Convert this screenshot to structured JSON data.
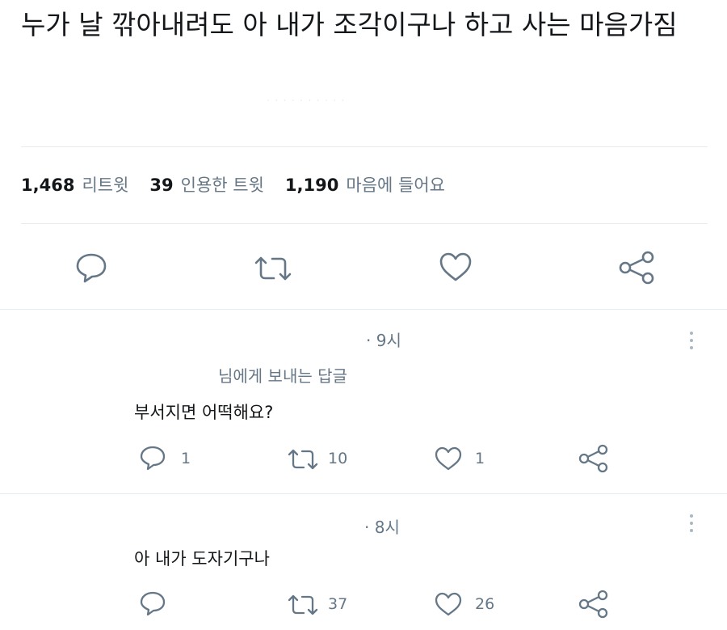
{
  "tweet": {
    "text": "누가 날 깎아내려도 아 내가 조각이구나 하고 사는 마음가짐",
    "meta_faint": "· · · · · · · · · ·"
  },
  "stats": {
    "retweets_count": "1,468",
    "retweets_label": "리트윗",
    "quotes_count": "39",
    "quotes_label": "인용한 트윗",
    "likes_count": "1,190",
    "likes_label": "마음에 들어요"
  },
  "actions": {
    "reply": "reply-icon",
    "retweet": "retweet-icon",
    "like": "heart-icon",
    "share": "share-icon"
  },
  "replies": [
    {
      "time": "· 9시",
      "replying_to": "님에게 보내는 답글",
      "text": "부서지면 어떡해요?",
      "reply_count": "1",
      "retweet_count": "10",
      "like_count": "1"
    },
    {
      "time": "· 8시",
      "text": "아 내가 도자기구나",
      "retweet_count": "37",
      "like_count": "26"
    }
  ],
  "colors": {
    "text": "#14171a",
    "secondary": "#657786",
    "divider": "#e6ecf0"
  }
}
